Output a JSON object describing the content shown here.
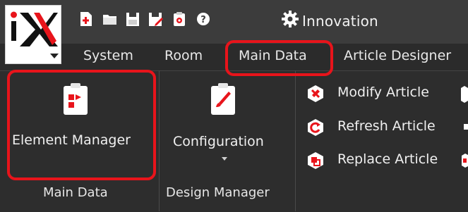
{
  "app": {
    "name": "Innovation",
    "logo_text": "iX"
  },
  "quick_access": [
    {
      "icon": "new-file-icon"
    },
    {
      "icon": "open-folder-icon"
    },
    {
      "icon": "save-icon"
    },
    {
      "icon": "save-as-icon"
    },
    {
      "icon": "clipboard-icon"
    },
    {
      "icon": "help-icon"
    },
    {
      "icon": "settings-gear-icon"
    }
  ],
  "tabs": [
    {
      "label": "System"
    },
    {
      "label": "Room"
    },
    {
      "label": "Main Data",
      "active": true
    },
    {
      "label": "Article Designer"
    }
  ],
  "ribbon": {
    "groups": [
      {
        "label": "Main Data",
        "buttons": [
          {
            "label": "Element Manager",
            "icon": "element-manager-icon"
          }
        ]
      },
      {
        "label": "Design Manager",
        "buttons": [
          {
            "label": "Configuration",
            "icon": "configuration-brush-icon",
            "has_dropdown": true
          }
        ]
      },
      {
        "label": "",
        "buttons": [
          {
            "label": "Modify Article",
            "icon": "modify-article-icon"
          },
          {
            "label": "Refresh Article",
            "icon": "refresh-article-icon"
          },
          {
            "label": "Replace Article",
            "icon": "replace-article-icon"
          }
        ]
      }
    ]
  },
  "colors": {
    "accent": "#e8141b",
    "background": "#2b2b2b",
    "titlebar": "#3c3c3c"
  }
}
